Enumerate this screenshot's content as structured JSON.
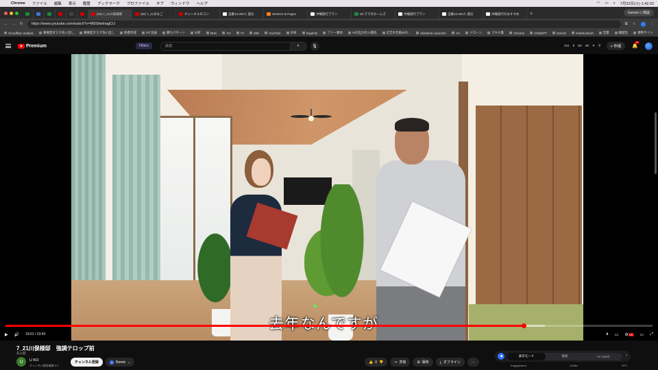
{
  "menubar": {
    "app": "Chrome",
    "items": [
      "ファイル",
      "編集",
      "表示",
      "履歴",
      "ブックマーク",
      "プロファイル",
      "タブ",
      "ウィンドウ",
      "ヘルプ"
    ],
    "clock": "7月22日(火) 1:42:32"
  },
  "tabs": [
    {
      "label": "",
      "color": "#1a8a3a"
    },
    {
      "label": "",
      "color": "#3a7bd5"
    },
    {
      "label": "",
      "color": "#1a8a3a"
    },
    {
      "label": "",
      "color": "#c00"
    },
    {
      "label": "",
      "color": "#444"
    },
    {
      "label": "",
      "color": "#c00"
    },
    {
      "label": "(53) 7_21川俣様邸",
      "color": "#c00",
      "active": true
    },
    {
      "label": "(60) 7_21あなご",
      "color": "#c00"
    },
    {
      "label": "チャンネルのコン",
      "color": "#c00"
    },
    {
      "label": "当番10,000人 進比",
      "color": "#fff"
    },
    {
      "label": "Workers & Pages",
      "color": "#f38020"
    },
    {
      "label": "沖縄旅行プラン",
      "color": "#fff"
    },
    {
      "label": "03.ママポホームズ",
      "color": "#1a8a3a"
    },
    {
      "label": "沖縄旅行プラン",
      "color": "#fff"
    },
    {
      "label": "当番10,000人 進比",
      "color": "#fff"
    },
    {
      "label": "沖縄旅行のおすすめ",
      "color": "#fff"
    }
  ],
  "gemini_button": "Gemini に相談",
  "address": "https://www.youtube.com/watch?v=M93dwtnagCU",
  "bookmarks": [
    "Cloudflare analytic",
    "重要度ダスク先い出し",
    "重要度タスク洗い出し",
    "他者作成",
    "SIT企画",
    "勝ちパターン",
    "分析",
    "NHK",
    "YH",
    "YT",
    "MM",
    "YouTube",
    "日本",
    "GigaFile",
    "フリー素材",
    "AIの出力の入稿先",
    "広告の仕組みの...",
    "Akashimi Launcher",
    "YH",
    "ドローン",
    "スキル集",
    "Chrome",
    "ChatGPT",
    "Gemini",
    "NotebookLM",
    "営業",
    "概配信",
    "便利サイト"
  ],
  "youtube": {
    "logo": "Premium",
    "filters": "Filters",
    "search_placeholder": "検索",
    "stats": [
      "311",
      "9",
      "50",
      "48"
    ],
    "create": "作成",
    "notif_count": "9+"
  },
  "player": {
    "subtitle": "去年なんですが",
    "time": "19:01 / 23:43",
    "progress": 0.801,
    "buffered": 0.834
  },
  "video": {
    "title": "7_21川俣様邸　強調テロップ前",
    "visibility": "非公開",
    "channel": "U KO",
    "channel_initial": "U",
    "subs": "チャンネル登録者数 5人",
    "subscribe": "チャンネル登録",
    "remix": "Remix",
    "likes": "0",
    "share": "共有",
    "save": "保存",
    "offline": "オフライン"
  },
  "panel": {
    "modes": [
      "表示モード",
      "検索",
      "AI Coach"
    ],
    "labels": [
      "Engagement",
      "Outlier",
      "VPH"
    ]
  }
}
